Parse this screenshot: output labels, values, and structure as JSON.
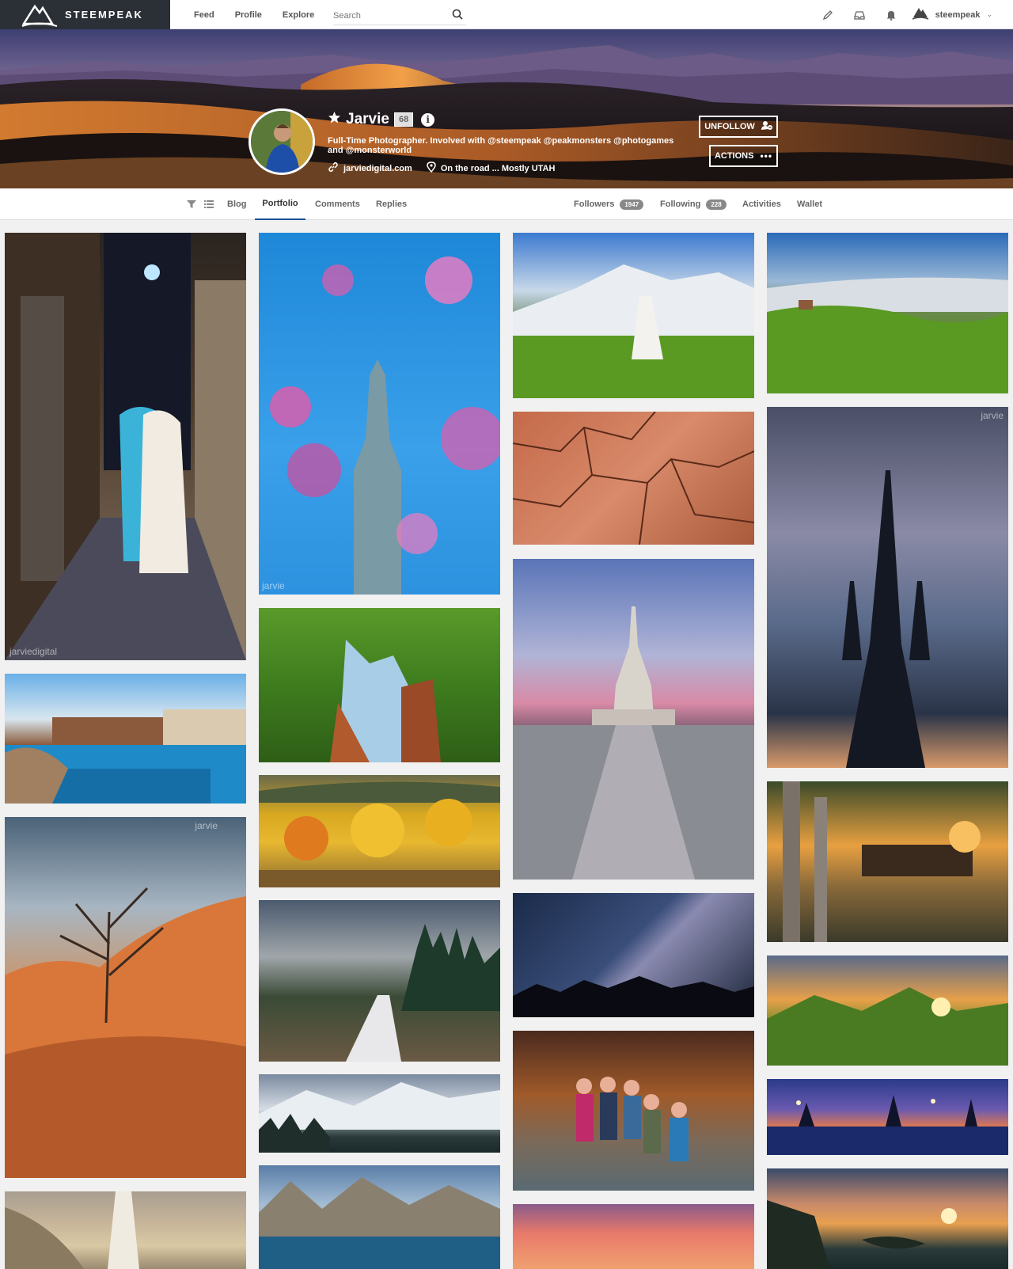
{
  "brand": {
    "name": "STEEMPEAK"
  },
  "nav": {
    "links": [
      "Feed",
      "Profile",
      "Explore"
    ],
    "search_placeholder": "Search",
    "username": "steempeak"
  },
  "profile": {
    "name": "Jarvie",
    "reputation": "68",
    "bio": "Full-Time Photographer. Involved with @steempeak @peakmonsters @photogames and @monsterworld",
    "website": "jarviedigital.com",
    "location": "On the road ... Mostly UTAH",
    "unfollow_label": "UNFOLLOW",
    "actions_label": "ACTIONS"
  },
  "tabs": {
    "blog": "Blog",
    "portfolio": "Portfolio",
    "comments": "Comments",
    "replies": "Replies",
    "followers": "Followers",
    "followers_count": "1947",
    "following": "Following",
    "following_count": "228",
    "activities": "Activities",
    "wallet": "Wallet"
  },
  "watermarks": {
    "jarviedigital": "jarviedigital",
    "jarvie": "jarvie"
  },
  "colors": {
    "accent": "#1a5099",
    "logo_bg": "#2b2f36"
  }
}
